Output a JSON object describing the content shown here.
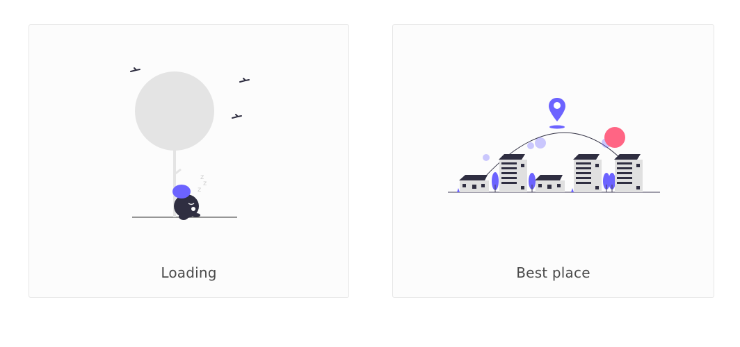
{
  "cards": [
    {
      "title": "Loading",
      "illustration_icon": "sleeping-under-tree-illustration",
      "sleep_text": "z z z"
    },
    {
      "title": "Best place",
      "illustration_icon": "city-location-illustration"
    }
  ],
  "colors": {
    "accent": "#6c63ff",
    "dark": "#2f2e41",
    "pink": "#ff6584",
    "tree_gray": "#e4e4e4",
    "card_bg": "#fcfcfc",
    "border": "#e6e6e6",
    "text": "#4a4a4a"
  }
}
